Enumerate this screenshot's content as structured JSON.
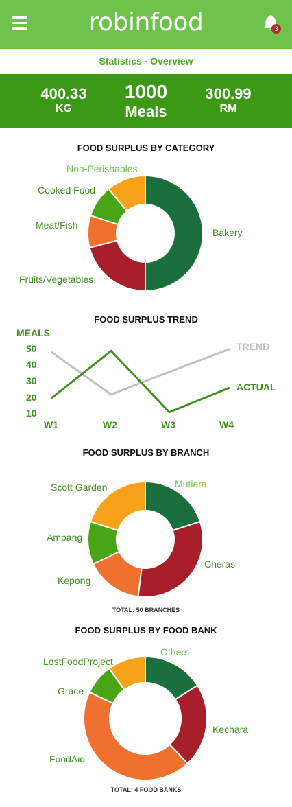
{
  "app": {
    "name": "robinfood",
    "notification_count": "3"
  },
  "page": {
    "subtitle": "Statistics - Overview"
  },
  "summary": [
    {
      "value": "400.33",
      "unit": "KG"
    },
    {
      "value": "1000",
      "unit": "Meals"
    },
    {
      "value": "300.99",
      "unit": "RM"
    }
  ],
  "icons": {
    "menu": "hamburger-menu-icon",
    "notifications": "bell-icon"
  },
  "colors": {
    "header": "#6cc24a",
    "stats_band": "#3b9916",
    "dark_green": "#1b6e3e",
    "red": "#a81f2c",
    "orange": "#f07030",
    "light_green": "#4aa516",
    "amber": "#f8a21a",
    "trend_gray": "#c0c0c0",
    "actual_green": "#3f8f1f"
  },
  "chart_data": [
    {
      "type": "pie",
      "title": "FOOD SURPLUS BY CATEGORY",
      "labels": [
        "Bakery",
        "Fruits/Vegetables",
        "Meat/Fish",
        "Cooked Food",
        "Non-Perishables"
      ],
      "values": [
        50,
        21,
        9,
        9,
        11
      ],
      "colors": [
        "#1b6e3e",
        "#a81f2c",
        "#f07030",
        "#4aa516",
        "#f8a21a"
      ]
    },
    {
      "type": "line",
      "title": "FOOD SURPLUS TREND",
      "ylabel": "MEALS",
      "categories": [
        "W1",
        "W2",
        "W3",
        "W4"
      ],
      "yticks": [
        10,
        20,
        30,
        40,
        50
      ],
      "ylim": [
        10,
        50
      ],
      "series": [
        {
          "name": "TREND",
          "values": [
            48,
            22,
            36,
            50
          ],
          "color": "#c0c0c0"
        },
        {
          "name": "ACTUAL",
          "values": [
            20,
            49,
            11,
            26
          ],
          "color": "#3f8f1f"
        }
      ]
    },
    {
      "type": "pie",
      "title": "FOOD SURPLUS BY BRANCH",
      "labels": [
        "Mutiara",
        "Cheras",
        "Kepong",
        "Ampang",
        "Scott Garden"
      ],
      "values": [
        20,
        32,
        16,
        12,
        20
      ],
      "colors": [
        "#1b6e3e",
        "#a81f2c",
        "#f07030",
        "#4aa516",
        "#f8a21a"
      ],
      "total": "TOTAL: 50 BRANCHES"
    },
    {
      "type": "pie",
      "title": "FOOD SURPLUS BY FOOD BANK",
      "labels": [
        "Others",
        "Kechara",
        "FoodAid",
        "Grace",
        "LostFoodProject"
      ],
      "values": [
        16,
        22,
        44,
        8,
        10
      ],
      "colors": [
        "#1b6e3e",
        "#a81f2c",
        "#f07030",
        "#4aa516",
        "#f8a21a"
      ],
      "total": "TOTAL: 4 FOOD BANKS"
    }
  ]
}
